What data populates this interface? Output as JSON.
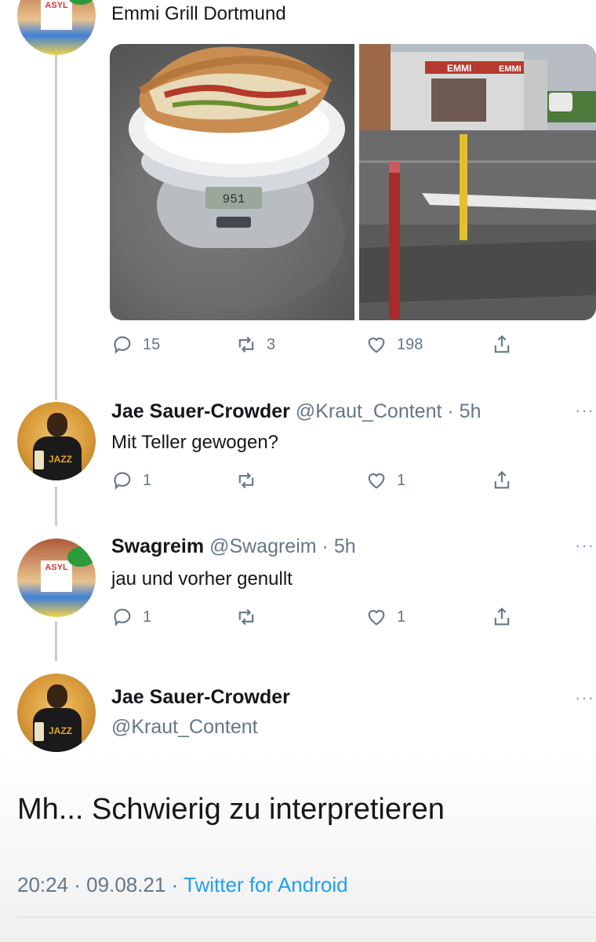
{
  "tweets": {
    "original": {
      "text": "Emmi Grill Dortmund",
      "replies": "15",
      "retweets": "3",
      "likes": "198",
      "media": {
        "scale_display": "951",
        "shop_sign": "EMMI",
        "shop_sign_2": "EMMI"
      }
    },
    "reply1": {
      "name": "Jae Sauer-Crowder",
      "handle": "@Kraut_Content",
      "time": "· 5h",
      "text": "Mit Teller gewogen?",
      "replies": "1",
      "likes": "1"
    },
    "reply2": {
      "name": "Swagreim",
      "handle": "@Swagreim",
      "time": "· 5h",
      "text": "jau und vorher genullt",
      "replies": "1",
      "likes": "1"
    },
    "main": {
      "name": "Jae Sauer-Crowder",
      "handle": "@Kraut_Content",
      "text": "Mh... Schwierig zu interpretieren",
      "timestamp": "20:24 · 09.08.21 ·",
      "source": "Twitter for Android"
    }
  },
  "more_label": "···",
  "avatar_sign": "ASYL",
  "avatar_jersey": "JAZZ",
  "colors": {
    "accent": "#1da1f2",
    "secondary_text": "#657786",
    "thread_line": "#c6cdd3"
  }
}
